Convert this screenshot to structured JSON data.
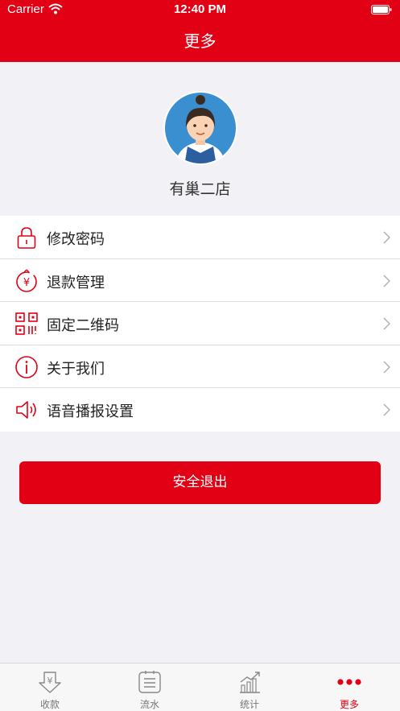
{
  "status_bar": {
    "carrier": "Carrier",
    "time": "12:40 PM"
  },
  "header": {
    "title": "更多"
  },
  "profile": {
    "store_name": "有巢二店"
  },
  "menu": [
    {
      "label": "修改密码",
      "icon": "lock-icon"
    },
    {
      "label": "退款管理",
      "icon": "refund-icon"
    },
    {
      "label": "固定二维码",
      "icon": "qr-code-icon"
    },
    {
      "label": "关于我们",
      "icon": "info-icon"
    },
    {
      "label": "语音播报设置",
      "icon": "speaker-icon"
    }
  ],
  "logout_label": "安全退出",
  "tabs": [
    {
      "label": "收款",
      "icon": "yuan-download-icon"
    },
    {
      "label": "流水",
      "icon": "list-icon"
    },
    {
      "label": "统计",
      "icon": "chart-icon"
    },
    {
      "label": "更多",
      "icon": "more-dots-icon",
      "active": true
    }
  ],
  "colors": {
    "brand_red": "#e10014",
    "background": "#f2f2f6"
  }
}
